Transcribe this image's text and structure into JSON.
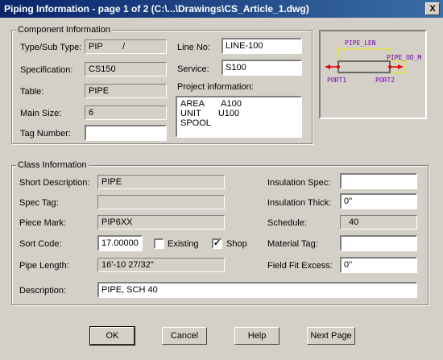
{
  "window": {
    "title": "Piping Information - page 1 of 2 (C:\\...\\Drawings\\CS_Article_1.dwg)",
    "close": "X"
  },
  "component": {
    "group_label": "Component Information",
    "type_label": "Type/Sub Type:",
    "type_value": "PIP        /",
    "spec_label": "Specification:",
    "spec_value": "CS150",
    "table_label": "Table:",
    "table_value": "PIPE",
    "mainsize_label": "Main Size:",
    "mainsize_value": "6",
    "tag_label": "Tag Number:",
    "tag_value": "",
    "lineno_label": "Line No:",
    "lineno_value": "LINE-100",
    "service_label": "Service:",
    "service_value": "S100",
    "project_label": "Project information:",
    "project_text": "AREA       A100\nUNIT       U100\nSPOOL"
  },
  "preview": {
    "pipe_len": "PIPE_LEN",
    "pipe_od": "PIPE_OD_M",
    "port1": "PORT1",
    "port2": "PORT2"
  },
  "class": {
    "group_label": "Class Information",
    "short_desc_label": "Short Description:",
    "short_desc_value": "PIPE",
    "spec_tag_label": "Spec Tag:",
    "spec_tag_value": "",
    "piece_mark_label": "Piece Mark:",
    "piece_mark_value": "PIP6XX",
    "sort_code_label": "Sort Code:",
    "sort_code_value": "17.00000",
    "existing_label": "Existing",
    "shop_label": "Shop",
    "pipe_length_label": "Pipe Length:",
    "pipe_length_value": "16'-10 27/32\"",
    "description_label": "Description:",
    "description_value": "PIPE, SCH 40",
    "ins_spec_label": "Insulation Spec:",
    "ins_spec_value": "",
    "ins_thick_label": "Insulation Thick:",
    "ins_thick_value": "0\"",
    "schedule_label": "Schedule:",
    "schedule_value": "40",
    "material_tag_label": "Material Tag:",
    "material_tag_value": "",
    "field_fit_label": "Field Fit Excess:",
    "field_fit_value": "0\""
  },
  "checkboxes": {
    "existing_checked": "",
    "shop_checked": "✓"
  },
  "buttons": {
    "ok": "OK",
    "cancel": "Cancel",
    "help": "Help",
    "next": "Next Page"
  }
}
